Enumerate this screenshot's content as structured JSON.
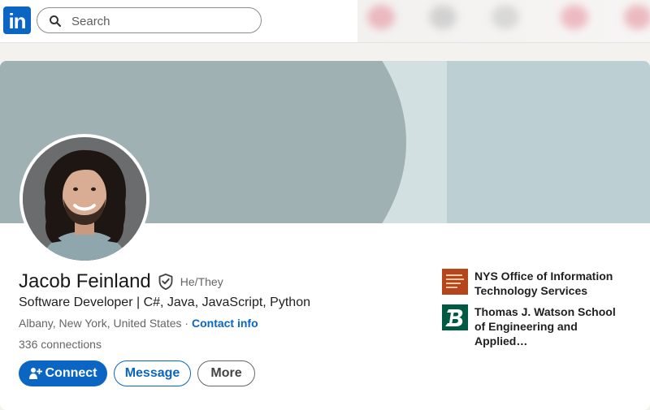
{
  "nav": {
    "logo_text": "in",
    "search_placeholder": "Search"
  },
  "profile": {
    "name": "Jacob Feinland",
    "pronouns": "He/They",
    "headline": "Software Developer | C#, Java, JavaScript, Python",
    "location": "Albany, New York, United States",
    "separator": " · ",
    "contact_link": "Contact info",
    "connections": "336 connections"
  },
  "actions": {
    "connect": "Connect",
    "message": "Message",
    "more": "More"
  },
  "organizations": [
    {
      "name": "NYS Office of Information Technology Services",
      "logo_color": "#b5451b"
    },
    {
      "name": "Thomas J. Watson School of Engineering and Applied…",
      "logo_color": "#005a43"
    }
  ],
  "colors": {
    "brand": "#0a66c2",
    "banner_light": "#bcd0d4",
    "banner_dark": "#9fb1b3"
  }
}
